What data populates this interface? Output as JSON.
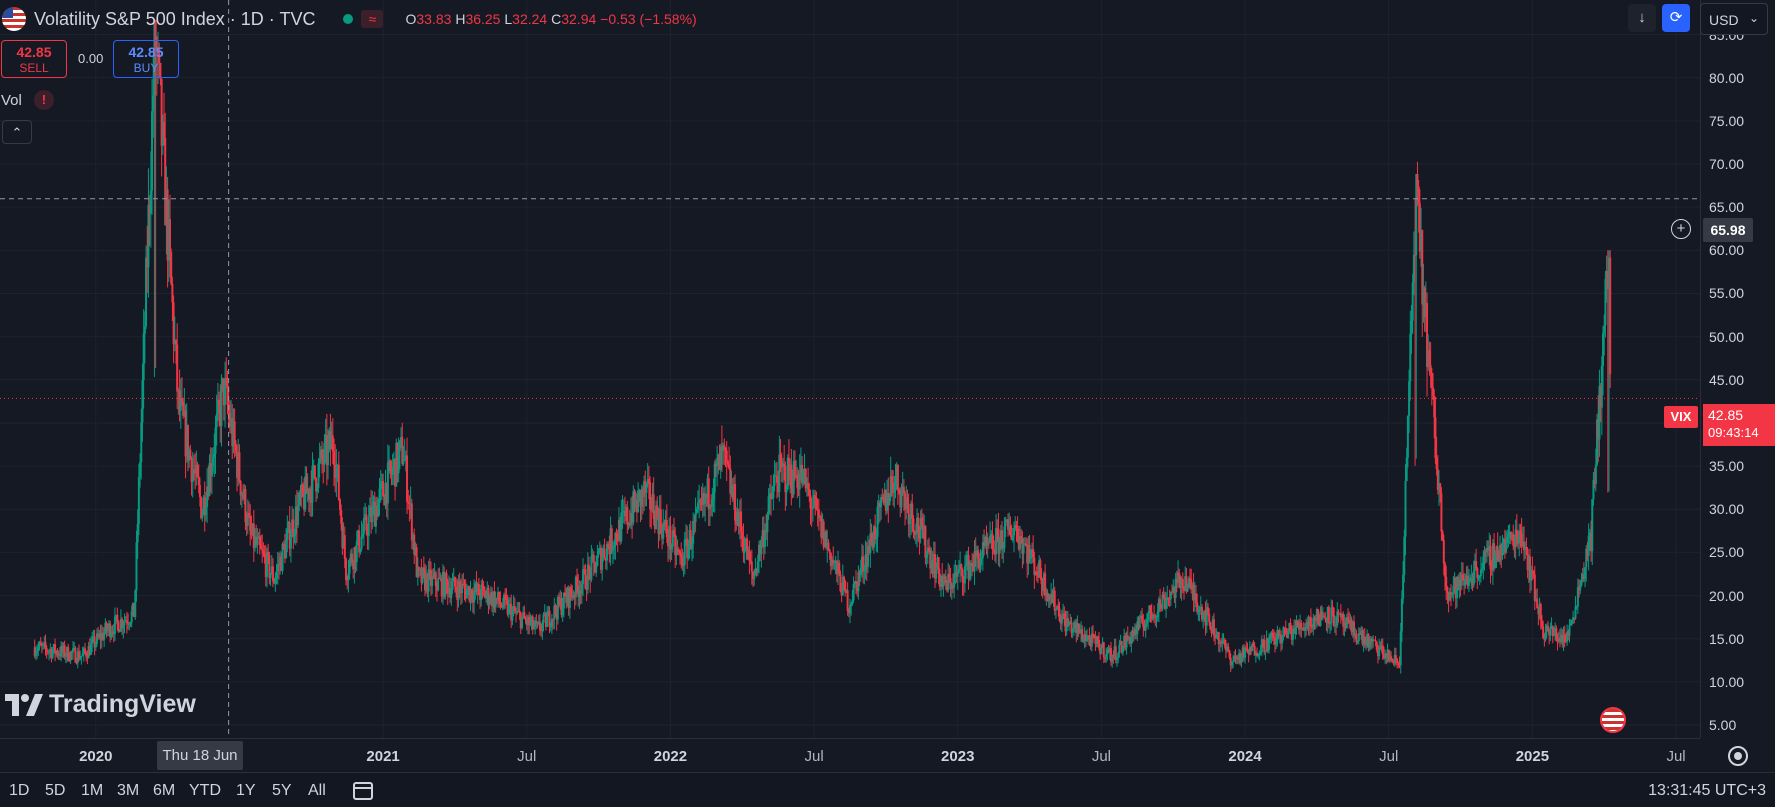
{
  "header": {
    "title": "Volatility S&P 500 Index · 1D · TVC",
    "ohlc": {
      "o_label": "O",
      "o": "33.83",
      "h_label": "H",
      "h": "36.25",
      "l_label": "L",
      "l": "32.24",
      "c_label": "C",
      "c": "32.94",
      "change": "−0.53 (−1.58%)"
    },
    "icons": [
      "us-flag-icon",
      "market-open-dot-icon",
      "wave-icon",
      "download-icon",
      "sync-icon"
    ]
  },
  "trade": {
    "sell_price": "42.85",
    "sell_label": "SELL",
    "spread": "0.00",
    "buy_price": "42.85",
    "buy_label": "BUY"
  },
  "indicator": {
    "label": "Vol",
    "warning": "!",
    "collapse": "⌃"
  },
  "currency": {
    "selected": "USD"
  },
  "price_axis": {
    "ticks": [
      "85.00",
      "80.00",
      "75.00",
      "70.00",
      "65.00",
      "60.00",
      "55.00",
      "50.00",
      "45.00",
      "40.00",
      "35.00",
      "30.00",
      "25.00",
      "20.00",
      "15.00",
      "10.00",
      "5.00"
    ],
    "crosshair_price": "65.98",
    "last_symbol": "VIX",
    "last_price": "42.85",
    "countdown": "09:43:14"
  },
  "time_axis": {
    "ticks": [
      {
        "label": "2020",
        "major": true
      },
      {
        "label": "2021",
        "major": true
      },
      {
        "label": "Jul",
        "major": false
      },
      {
        "label": "2022",
        "major": true
      },
      {
        "label": "Jul",
        "major": false
      },
      {
        "label": "2023",
        "major": true
      },
      {
        "label": "Jul",
        "major": false
      },
      {
        "label": "2024",
        "major": true
      },
      {
        "label": "Jul",
        "major": false
      },
      {
        "label": "2025",
        "major": true
      },
      {
        "label": "Jul",
        "major": false
      }
    ],
    "crosshair_date": "Thu 18 Jun '20"
  },
  "range_buttons": [
    "1D",
    "5D",
    "1M",
    "3M",
    "6M",
    "YTD",
    "1Y",
    "5Y",
    "All"
  ],
  "clock": "13:31:45 UTC+3",
  "branding": {
    "logo_text": "TradingView"
  },
  "colors": {
    "up": "#089981",
    "down": "#f23645",
    "background": "#151924",
    "grid": "#1e222d",
    "accent": "#2962ff"
  },
  "chart_data": {
    "type": "candlestick",
    "symbol": "VIX",
    "timeframe": "1D",
    "ylim": [
      3.5,
      89
    ],
    "x_range": [
      "2019-09",
      "2025-08"
    ],
    "key_points": [
      {
        "date": "2019-10",
        "value": 14
      },
      {
        "date": "2019-12",
        "value": 13
      },
      {
        "date": "2020-01",
        "value": 16
      },
      {
        "date": "2020-02-20",
        "value": 18
      },
      {
        "date": "2020-03-16",
        "value": 85
      },
      {
        "date": "2020-04",
        "value": 42
      },
      {
        "date": "2020-05",
        "value": 30
      },
      {
        "date": "2020-06-12",
        "value": 44
      },
      {
        "date": "2020-07",
        "value": 27
      },
      {
        "date": "2020-08",
        "value": 22
      },
      {
        "date": "2020-09",
        "value": 30
      },
      {
        "date": "2020-10-30",
        "value": 38
      },
      {
        "date": "2020-11",
        "value": 23
      },
      {
        "date": "2021-01-27",
        "value": 37
      },
      {
        "date": "2021-02",
        "value": 22
      },
      {
        "date": "2021-05",
        "value": 20
      },
      {
        "date": "2021-07",
        "value": 16
      },
      {
        "date": "2021-09",
        "value": 22
      },
      {
        "date": "2021-11-30",
        "value": 32
      },
      {
        "date": "2022-01",
        "value": 24
      },
      {
        "date": "2022-03-07",
        "value": 36
      },
      {
        "date": "2022-04",
        "value": 22
      },
      {
        "date": "2022-05",
        "value": 34
      },
      {
        "date": "2022-06",
        "value": 34
      },
      {
        "date": "2022-08",
        "value": 19
      },
      {
        "date": "2022-10-12",
        "value": 34
      },
      {
        "date": "2022-12",
        "value": 21
      },
      {
        "date": "2023-03-13",
        "value": 28
      },
      {
        "date": "2023-05",
        "value": 17
      },
      {
        "date": "2023-07",
        "value": 13
      },
      {
        "date": "2023-10",
        "value": 22
      },
      {
        "date": "2023-12",
        "value": 12.5
      },
      {
        "date": "2024-04",
        "value": 18
      },
      {
        "date": "2024-07",
        "value": 12
      },
      {
        "date": "2024-08-05",
        "value": 65.98
      },
      {
        "date": "2024-09",
        "value": 20
      },
      {
        "date": "2024-12-18",
        "value": 27.6
      },
      {
        "date": "2025-01",
        "value": 16
      },
      {
        "date": "2025-02",
        "value": 15
      },
      {
        "date": "2025-03",
        "value": 27
      },
      {
        "date": "2025-04-07",
        "value": 60
      },
      {
        "date": "2025-04-09",
        "value": 42.85
      }
    ],
    "last_candle": {
      "open": 33.83,
      "high": 36.25,
      "low": 32.24,
      "close": 32.94
    },
    "horizontal_lines": [
      {
        "value": 65.98,
        "style": "dashed",
        "label": "crosshair"
      },
      {
        "value": 42.85,
        "style": "dotted",
        "label": "last price"
      }
    ],
    "crosshair": {
      "date": "2020-06-18",
      "value": 65.98
    }
  }
}
